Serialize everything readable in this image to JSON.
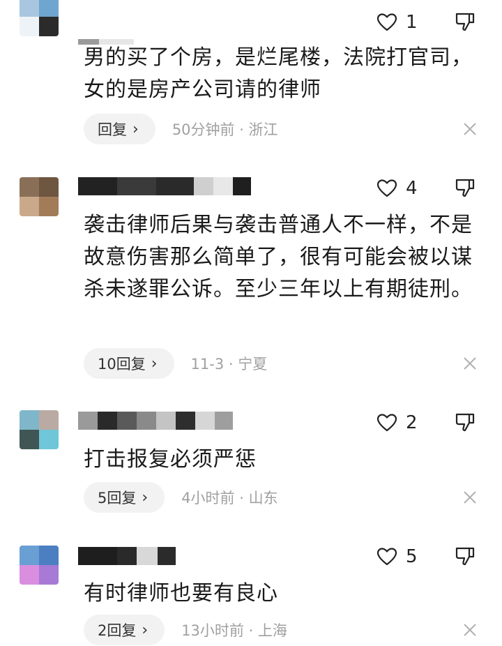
{
  "comments": [
    {
      "likes": "1",
      "text": "男的买了个房，是烂尾楼，法院打官司，女的是房产公司请的律师",
      "reply_label": "回复",
      "time": "50分钟前 · 浙江",
      "avatar_colors": [
        "#a9c6e0",
        "#6fa6cf",
        "#ffffff",
        "#2b2b2b"
      ],
      "name_colors": [
        "#888888",
        "#e0e0e0",
        "#f0f0f0"
      ]
    },
    {
      "likes": "4",
      "text": "袭击律师后果与袭击普通人不一样，不是故意伤害那么简单了，很有可能会被以谋杀未遂罪公诉。至少三年以上有期徒刑。",
      "reply_label": "10回复",
      "time": "11-3 · 宁夏",
      "avatar_colors": [
        "#8a6f58",
        "#6e5640",
        "#caa98b",
        "#a27b59"
      ],
      "name_colors": [
        "#222222",
        "#3a3a3a",
        "#2a2a2a",
        "#555555",
        "#cfcfcf",
        "#e8e8e8",
        "#1f1f1f"
      ]
    },
    {
      "likes": "2",
      "text": "打击报复必须严惩",
      "reply_label": "5回复",
      "time": "4小时前 · 山东",
      "avatar_colors": [
        "#7fb6c9",
        "#b9aaa4",
        "#3f5654",
        "#6ec6d8"
      ],
      "name_colors": [
        "#9a9a9a",
        "#2a2a2a",
        "#5a5a5a",
        "#8a8a8a",
        "#c4c4c4",
        "#2e2e2e",
        "#d6d6d6",
        "#9e9e9e"
      ]
    },
    {
      "likes": "5",
      "text": "有时律师也要有良心",
      "reply_label": "2回复",
      "time": "13小时前 · 上海",
      "avatar_colors": [
        "#6a9fd4",
        "#4b7fc2",
        "#d98ee0",
        "#a77ad6"
      ],
      "name_colors": [
        "#1e1e1e",
        "#2a2a2a",
        "#d8d8d8",
        "#2b2b2b"
      ]
    }
  ]
}
